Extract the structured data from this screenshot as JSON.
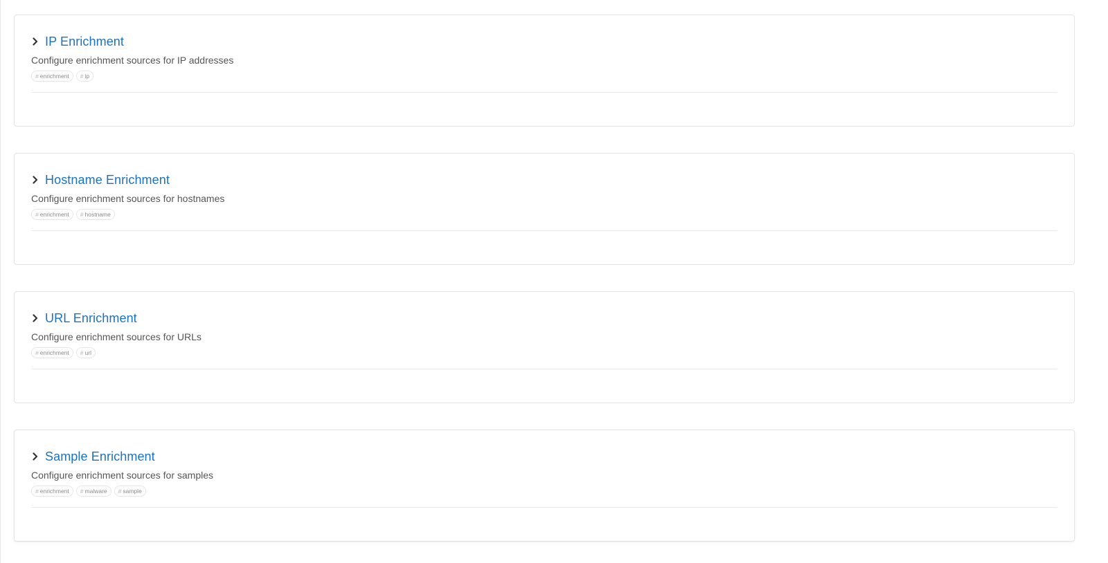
{
  "sections": [
    {
      "title": "IP Enrichment",
      "description": "Configure enrichment sources for IP addresses",
      "tags": [
        "enrichment",
        "ip"
      ]
    },
    {
      "title": "Hostname Enrichment",
      "description": "Configure enrichment sources for hostnames",
      "tags": [
        "enrichment",
        "hostname"
      ]
    },
    {
      "title": "URL Enrichment",
      "description": "Configure enrichment sources for URLs",
      "tags": [
        "enrichment",
        "url"
      ]
    },
    {
      "title": "Sample Enrichment",
      "description": "Configure enrichment sources for samples",
      "tags": [
        "enrichment",
        "malware",
        "sample"
      ]
    }
  ],
  "tag_prefix": "#",
  "icons": {
    "expand": "chevron-right-icon"
  },
  "colors": {
    "title": "#1a73c1",
    "description": "#555555",
    "tag_text": "#8a8a8a",
    "border": "#e4e4e4"
  }
}
